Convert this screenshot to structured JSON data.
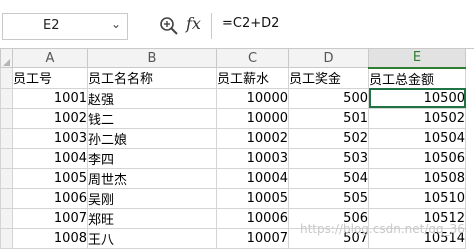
{
  "name_box": {
    "value": "E2"
  },
  "formula_bar": {
    "fx_label": "fx",
    "formula": "=C2+D2"
  },
  "columns": [
    "A",
    "B",
    "C",
    "D",
    "E"
  ],
  "active_column": "E",
  "header_row": [
    "员工号",
    "员工名名称",
    "员工薪水",
    "员工奖金",
    "员工总金额"
  ],
  "rows": [
    [
      "1001",
      "赵强",
      "10000",
      "500",
      "10500"
    ],
    [
      "1002",
      "钱二",
      "10000",
      "501",
      "10502"
    ],
    [
      "1003",
      "孙二娘",
      "10002",
      "502",
      "10504"
    ],
    [
      "1004",
      "李四",
      "10003",
      "503",
      "10506"
    ],
    [
      "1005",
      "周世杰",
      "10004",
      "504",
      "10508"
    ],
    [
      "1006",
      "吴刚",
      "10005",
      "505",
      "10510"
    ],
    [
      "1007",
      "郑旺",
      "10006",
      "506",
      "10512"
    ],
    [
      "1008",
      "王八",
      "10007",
      "507",
      "10514"
    ]
  ],
  "watermark": "https://blog.csdn.net/qq_36"
}
